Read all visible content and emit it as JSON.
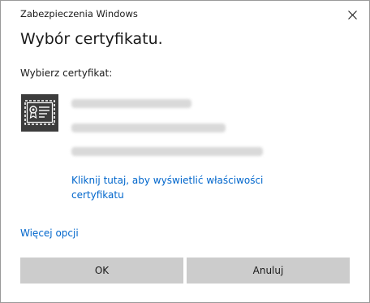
{
  "window": {
    "title": "Zabezpieczenia Windows"
  },
  "dialog": {
    "heading": "Wybór certyfikatu.",
    "prompt": "Wybierz certyfikat:",
    "certificate": {
      "icon": "certificate-icon"
    },
    "cert_details_link": "Kliknij tutaj, aby wyświetlić właściwości certyfikatu",
    "more_options_link": "Więcej opcji"
  },
  "buttons": {
    "ok": "OK",
    "cancel": "Anuluj"
  },
  "colors": {
    "link": "#0066cc",
    "button_bg": "#cccccc",
    "icon_bg": "#3c3c3c"
  }
}
